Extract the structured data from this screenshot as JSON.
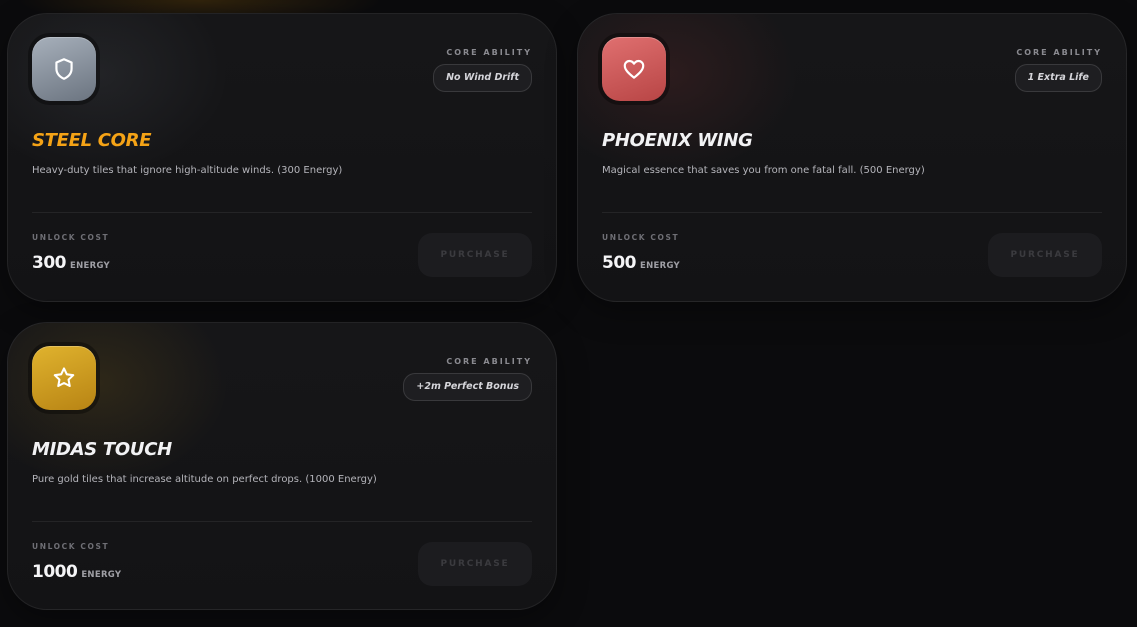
{
  "cards": [
    {
      "icon": "shield-icon",
      "icon_gradient": [
        "#a7b0bb",
        "#6b7480"
      ],
      "glow_color": "rgba(150,160,175,0.10)",
      "ability_label": "CORE ABILITY",
      "ability": "No Wind Drift",
      "title": "STEEL CORE",
      "title_color": "#f5a316",
      "description": "Heavy-duty tiles that ignore high-altitude winds. (300 Energy)",
      "unlock_label": "UNLOCK COST",
      "cost": "300",
      "cost_unit": "ENERGY",
      "button": "PURCHASE"
    },
    {
      "icon": "heart-icon",
      "icon_gradient": [
        "#e07070",
        "#b84545"
      ],
      "glow_color": "rgba(200,70,70,0.13)",
      "ability_label": "CORE ABILITY",
      "ability": "1 Extra Life",
      "title": "PHOENIX WING",
      "title_color": "#f2f2f4",
      "description": "Magical essence that saves you from one fatal fall. (500 Energy)",
      "unlock_label": "UNLOCK COST",
      "cost": "500",
      "cost_unit": "ENERGY",
      "button": "PURCHASE"
    },
    {
      "icon": "star-icon",
      "icon_gradient": [
        "#e0b32e",
        "#b88414"
      ],
      "glow_color": "rgba(210,160,30,0.13)",
      "ability_label": "CORE ABILITY",
      "ability": "+2m Perfect Bonus",
      "title": "MIDAS TOUCH",
      "title_color": "#f2f2f4",
      "description": "Pure gold tiles that increase altitude on perfect drops. (1000 Energy)",
      "unlock_label": "UNLOCK COST",
      "cost": "1000",
      "cost_unit": "ENERGY",
      "button": "PURCHASE"
    }
  ]
}
